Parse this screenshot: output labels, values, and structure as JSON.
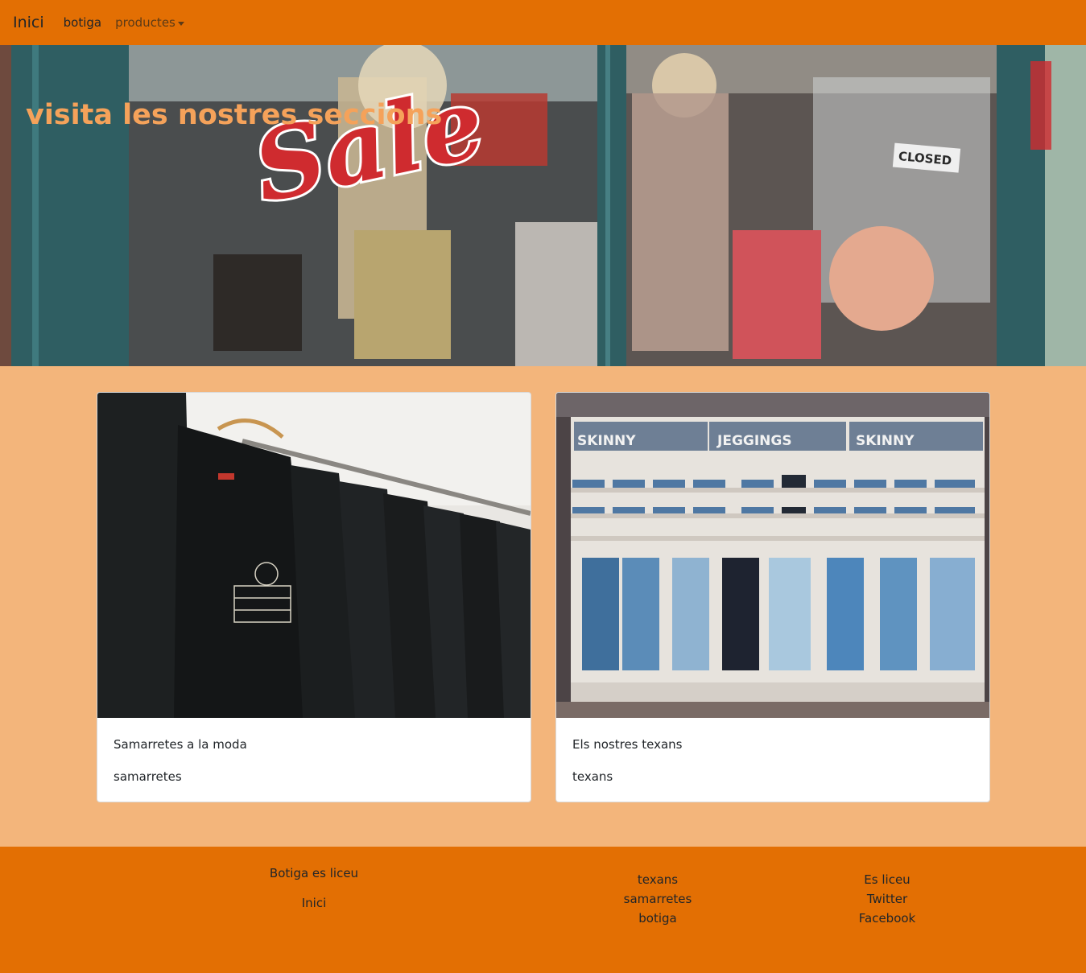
{
  "navbar": {
    "brand": "Inici",
    "links": [
      {
        "label": "botiga"
      },
      {
        "label": "productes"
      }
    ]
  },
  "hero": {
    "title": "visita les nostres seccions",
    "image_text": [
      "Sale",
      "CLOSED"
    ]
  },
  "cards": [
    {
      "title": "Samarretes a la moda",
      "link": "samarretes",
      "image": "black-tshirts-on-hangers"
    },
    {
      "title": "Els nostres texans",
      "link": "texans",
      "image": "jeans-store-shelves",
      "image_text": [
        "SKINNY",
        "JEGGINGS",
        "SKINNY"
      ]
    }
  ],
  "footer": {
    "col1": {
      "title": "Botiga es liceu",
      "link": "Inici"
    },
    "col2": [
      "texans",
      "samarretes",
      "botiga"
    ],
    "col3": [
      "Es liceu",
      "Twitter",
      "Facebook"
    ]
  },
  "colors": {
    "navbar": "#e36f03",
    "page_bg": "#f3b57b",
    "hero_title": "#f5a25a",
    "footer": "#e36f03"
  }
}
